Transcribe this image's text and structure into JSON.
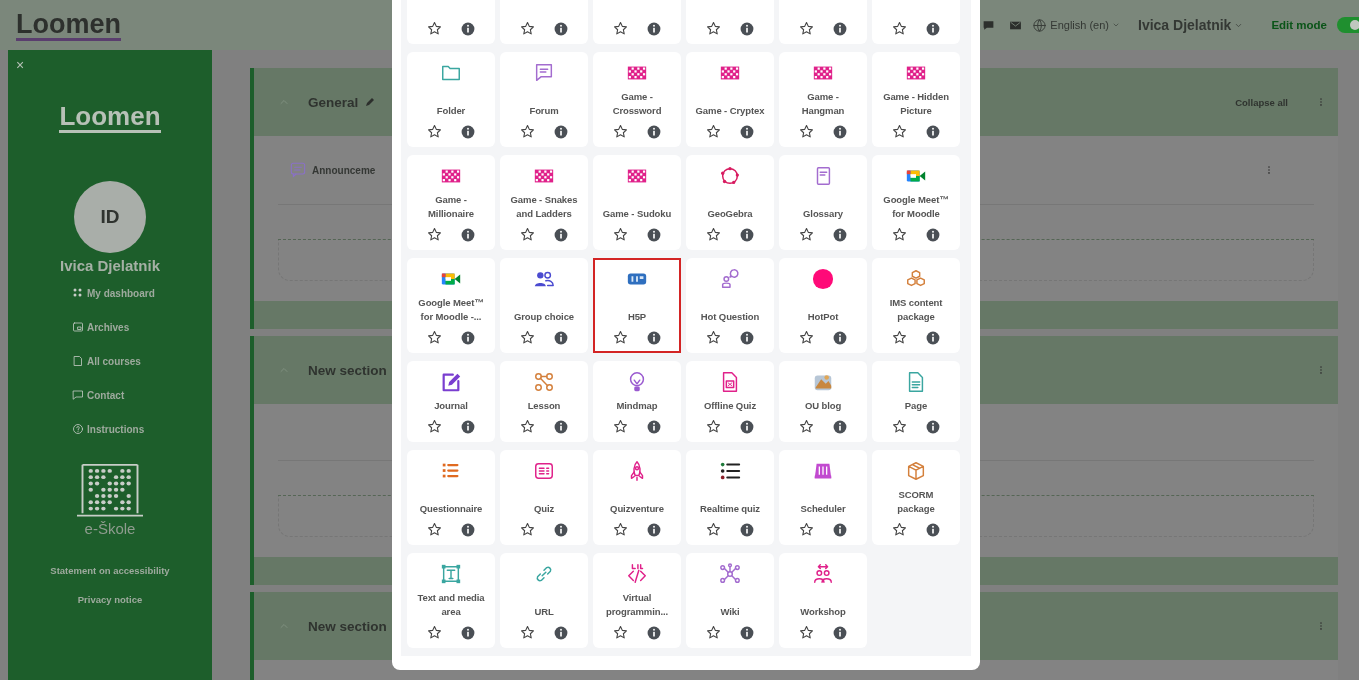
{
  "header": {
    "logo": "Loomen",
    "language": "English (en)",
    "user": "Ivica Djelatnik",
    "edit_mode": {
      "label": "Edit mode",
      "on": true
    }
  },
  "sidebar": {
    "close": "×",
    "logo": "Loomen",
    "avatar": "ID",
    "user_name": "Ivica Djelatnik",
    "nav": [
      {
        "label": "My dashboard"
      },
      {
        "label": "Archives"
      },
      {
        "label": "All courses"
      },
      {
        "label": "Contact"
      },
      {
        "label": "Instructions"
      }
    ],
    "brand": "e-Škole",
    "footer_links": [
      "Statement on accessibility",
      "Privacy notice"
    ]
  },
  "course": {
    "collapse_all": "Collapse all",
    "sections": [
      {
        "title": "General",
        "editable": true,
        "activities": [
          {
            "name": "Announceme"
          }
        ]
      },
      {
        "title": "New section"
      },
      {
        "title": "New section"
      }
    ]
  },
  "chooser": {
    "cut_tiles": [
      {
        "starred": false
      },
      {
        "starred": false
      },
      {
        "starred": false
      },
      {
        "starred": false
      },
      {
        "starred": false
      },
      {
        "starred": false
      }
    ],
    "tiles": [
      {
        "name": "Folder",
        "starred": false,
        "selected": false
      },
      {
        "name": "Forum",
        "starred": false,
        "selected": false
      },
      {
        "name": "Game - Crossword",
        "starred": false,
        "selected": false
      },
      {
        "name": "Game - Cryptex",
        "starred": false,
        "selected": false
      },
      {
        "name": "Game - Hangman",
        "starred": false,
        "selected": false
      },
      {
        "name": "Game - Hidden Picture",
        "starred": false,
        "selected": false
      },
      {
        "name": "Game - Millionaire",
        "starred": false,
        "selected": false
      },
      {
        "name": "Game - Snakes and Ladders",
        "starred": false,
        "selected": false
      },
      {
        "name": "Game - Sudoku",
        "starred": false,
        "selected": false
      },
      {
        "name": "GeoGebra",
        "starred": false,
        "selected": false
      },
      {
        "name": "Glossary",
        "starred": false,
        "selected": false
      },
      {
        "name": "Google Meet™ for Moodle",
        "starred": false,
        "selected": false
      },
      {
        "name": "Google Meet™ for Moodle -...",
        "starred": false,
        "selected": false
      },
      {
        "name": "Group choice",
        "starred": false,
        "selected": false
      },
      {
        "name": "H5P",
        "starred": false,
        "selected": true
      },
      {
        "name": "Hot Question",
        "starred": false,
        "selected": false
      },
      {
        "name": "HotPot",
        "starred": false,
        "selected": false
      },
      {
        "name": "IMS content package",
        "starred": false,
        "selected": false
      },
      {
        "name": "Journal",
        "starred": false,
        "selected": false
      },
      {
        "name": "Lesson",
        "starred": false,
        "selected": false
      },
      {
        "name": "Mindmap",
        "starred": false,
        "selected": false
      },
      {
        "name": "Offline Quiz",
        "starred": false,
        "selected": false
      },
      {
        "name": "OU blog",
        "starred": false,
        "selected": false
      },
      {
        "name": "Page",
        "starred": false,
        "selected": false
      },
      {
        "name": "Questionnaire",
        "starred": false,
        "selected": false
      },
      {
        "name": "Quiz",
        "starred": false,
        "selected": false
      },
      {
        "name": "Quizventure",
        "starred": false,
        "selected": false
      },
      {
        "name": "Realtime quiz",
        "starred": false,
        "selected": false
      },
      {
        "name": "Scheduler",
        "starred": false,
        "selected": false
      },
      {
        "name": "SCORM package",
        "starred": false,
        "selected": false
      },
      {
        "name": "Text and media area",
        "starred": false,
        "selected": false
      },
      {
        "name": "URL",
        "starred": false,
        "selected": false
      },
      {
        "name": "Virtual programmin...",
        "starred": false,
        "selected": false
      },
      {
        "name": "Wiki",
        "starred": false,
        "selected": false
      },
      {
        "name": "Workshop",
        "starred": false,
        "selected": false
      }
    ]
  }
}
